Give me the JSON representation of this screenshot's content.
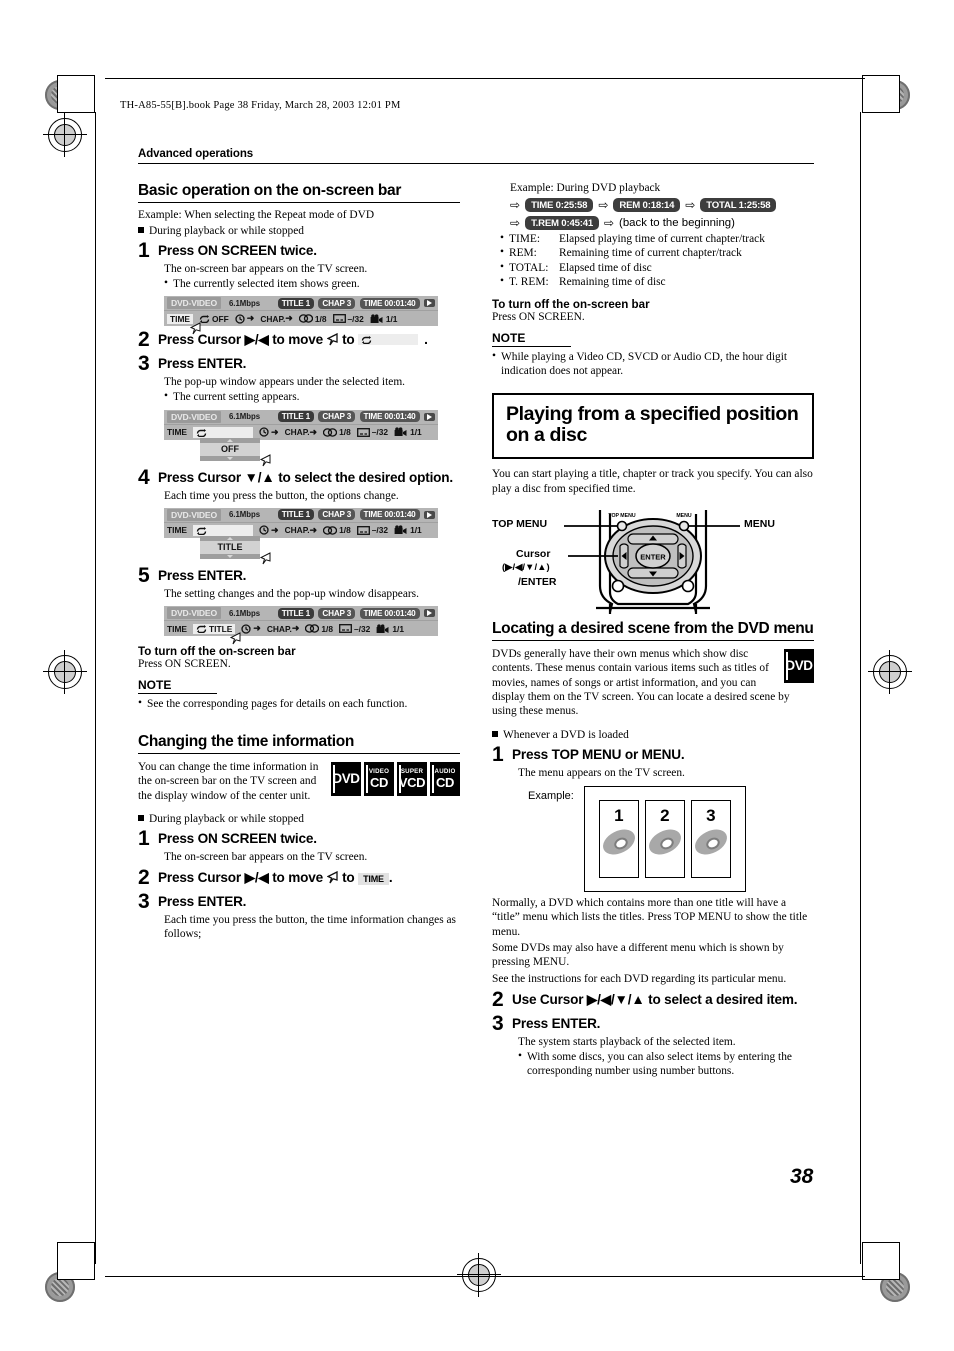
{
  "header": {
    "book_line": "TH-A85-55[B].book  Page 38  Friday, March 28, 2003  12:01 PM",
    "running_head": "Advanced operations",
    "page_number": "38"
  },
  "left_column": {
    "section1": {
      "title": "Basic operation on the on-screen bar",
      "example": "Example: When selecting the Repeat mode of DVD",
      "condition": "During playback or while stopped",
      "step1": {
        "num": "1",
        "title": "Press ON SCREEN twice.",
        "desc": "The on-screen bar appears on the TV screen.",
        "bullets": [
          "The currently selected item shows green."
        ]
      },
      "step2": {
        "num": "2",
        "title_a": "Press Cursor",
        "cursor": "▶/◀",
        "title_b": "to move",
        "pointer": "↖",
        "title_c": "to",
        "target": "repeat-icon",
        "end": "."
      },
      "step3": {
        "num": "3",
        "title": "Press ENTER.",
        "desc": "The pop-up window appears under the selected item.",
        "bullets": [
          "The current setting appears."
        ]
      },
      "step4": {
        "num": "4",
        "title": "Press Cursor ▼/▲ to select the desired option.",
        "desc": "Each time you press the button, the options change."
      },
      "step5": {
        "num": "5",
        "title": "Press ENTER.",
        "desc": "The setting changes and the pop-up window disappears."
      },
      "turnoff_head": "To turn off the on-screen bar",
      "turnoff_body": "Press ON SCREEN.",
      "note_head": "NOTE",
      "note_items": [
        "See the corresponding pages for details on each function."
      ]
    },
    "section2": {
      "title": "Changing the time information",
      "intro": "You can change the time information in the on-screen bar on the TV screen and the display window of the center unit.",
      "logos": [
        {
          "top": "",
          "big": "DVD"
        },
        {
          "top": "VIDEO",
          "big": "CD"
        },
        {
          "top": "SUPER",
          "big": "VCD"
        },
        {
          "top": "AUDIO",
          "big": "CD"
        }
      ],
      "condition": "During playback or while stopped",
      "step1": {
        "num": "1",
        "title": "Press ON SCREEN twice.",
        "desc": "The on-screen bar appears on the TV screen."
      },
      "step2": {
        "num": "2",
        "title_a": "Press Cursor",
        "cursor": "▶/◀",
        "title_b": "to move",
        "pointer": "↖",
        "title_c": "to",
        "target": "TIME",
        "end": "."
      },
      "step3": {
        "num": "3",
        "title": "Press ENTER.",
        "desc": "Each time you press the button, the time information changes as follows;"
      }
    }
  },
  "osd_bars": {
    "bar1": {
      "disc_type": "DVD-VIDEO",
      "bitrate": "6.1Mbps",
      "title_tag": "TITLE  1",
      "chap_tag": "CHAP  3",
      "time_tag": "TIME 00:01:40",
      "play_icon": "play-icon",
      "row2": {
        "time_label": "TIME",
        "repeat_icon": "repeat-icon",
        "repeat_value": "OFF",
        "clock_icon": "clock-icon",
        "clock_arrow": "➜",
        "chap_label": "CHAP.",
        "chap_arrow": "➜",
        "audio_icon": "audio-icon",
        "audio_value": "1/8",
        "subtitle_icon": "subtitle-icon",
        "subtitle_value": "–/32",
        "angle_icon": "angle-icon",
        "angle_value": "1/1"
      },
      "cursor": "cursor-pointer"
    },
    "bar2_popup_value": "OFF",
    "bar3_popup_value": "TITLE",
    "bar4_repeat_value": "TITLE"
  },
  "right_column": {
    "time_example": {
      "label": "Example: During DVD playback",
      "sequence_row1": [
        "TIME  0:25:58",
        "REM  0:18:14",
        "TOTAL  1:25:58"
      ],
      "sequence_row2": [
        "T.REM 0:45:41"
      ],
      "loop_note": "(back to the beginning)",
      "definitions": [
        {
          "term": "TIME:",
          "desc": "Elapsed playing time of current chapter/track"
        },
        {
          "term": "REM:",
          "desc": "Remaining time of current chapter/track"
        },
        {
          "term": "TOTAL:",
          "desc": "Elapsed time of disc"
        },
        {
          "term": "T. REM:",
          "desc": "Remaining time of disc"
        }
      ]
    },
    "turnoff_head": "To turn off the on-screen bar",
    "turnoff_body": "Press ON SCREEN.",
    "note_head": "NOTE",
    "note_items": [
      "While playing a Video CD, SVCD or Audio CD, the hour digit indication does not appear."
    ],
    "big_heading": "Playing from a specified position on a disc",
    "intro": "You can start playing a title, chapter or track you specify. You can also play a disc from specified time.",
    "remote": {
      "top_menu_label": "TOP MENU",
      "menu_label": "MENU",
      "cursor_label": "Cursor",
      "cursor_keys": "(▶/◀/▼/▲)",
      "enter_label": "/ENTER",
      "button_top_menu": "TOP MENU",
      "button_menu": "MENU",
      "center_label": "ENTER",
      "up": "▲",
      "down": "▼",
      "left": "◀",
      "right": "▶"
    },
    "section3": {
      "title": "Locating a desired scene from the DVD menu",
      "intro": "DVDs generally have their own menus which show disc contents. These menus contain various items such as titles of movies, names of songs or artist information, and you can display them on the TV screen. You can locate a desired scene by using these menus.",
      "logo": {
        "top": "",
        "big": "DVD"
      },
      "condition": "Whenever a DVD is loaded",
      "step1": {
        "num": "1",
        "title": "Press TOP MENU or MENU.",
        "desc": "The menu appears on the TV screen."
      },
      "example_label": "Example:",
      "thumbnails": [
        "1",
        "2",
        "3"
      ],
      "after_example": [
        "Normally, a DVD which contains more than one title will have a “title” menu which lists the titles. Press TOP MENU to show the title menu.",
        "Some DVDs may also have a different menu which is shown by pressing MENU.",
        "See the instructions for each DVD regarding its particular menu."
      ],
      "step2": {
        "num": "2",
        "title": "Use Cursor ▶/◀/▼/▲ to select a desired item."
      },
      "step3": {
        "num": "3",
        "title": "Press ENTER.",
        "desc": "The system starts playback of the selected item.",
        "bullets": [
          "With some discs, you can also select items by entering the corresponding number using number buttons."
        ]
      }
    }
  },
  "colors": {
    "osd_bg": "#b5b5b5",
    "osd_tag": "#9a9a9a",
    "osd_dark": "#3a3a3a",
    "ink": "#000000"
  }
}
